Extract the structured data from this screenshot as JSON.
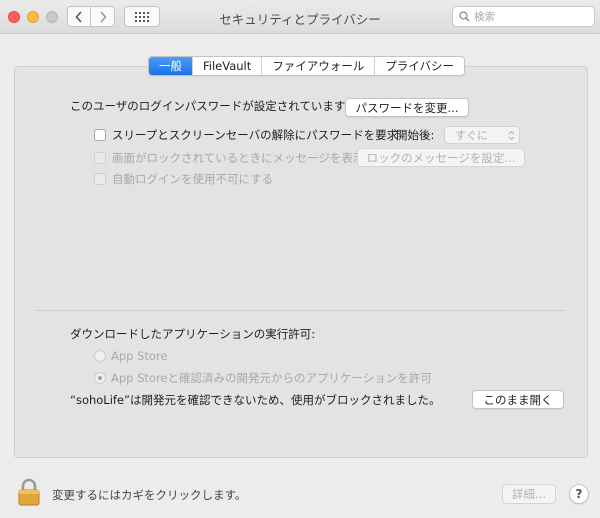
{
  "window": {
    "title": "セキュリティとプライバシー",
    "search_placeholder": "検索",
    "back_icon": "chevron-left-icon",
    "forward_icon": "chevron-right-icon",
    "grid_icon": "grid-icon"
  },
  "tabs": [
    {
      "label": "一般",
      "active": true
    },
    {
      "label": "FileVault",
      "active": false
    },
    {
      "label": "ファイアウォール",
      "active": false
    },
    {
      "label": "プライバシー",
      "active": false
    }
  ],
  "general": {
    "password_label": "このユーザのログインパスワードが設定されています",
    "change_password_button": "パスワードを変更...",
    "require_password_label": "スリープとスクリーンセーバの解除にパスワードを要求",
    "start_label": "開始後:",
    "start_value": "すぐに",
    "lock_message_label": "画面がロックされているときにメッセージを表示",
    "lock_message_button": "ロックのメッセージを設定...",
    "disable_autologin_label": "自動ログインを使用不可にする"
  },
  "downloads": {
    "heading": "ダウンロードしたアプリケーションの実行許可:",
    "option_app_store": "App Store",
    "option_app_store_identified": "App Storeと確認済みの開発元からのアプリケーションを許可",
    "blocked_message": "“sohoLife”は開発元を確認できないため、使用がブロックされました。",
    "open_anyway_button": "このまま開く"
  },
  "footer": {
    "lock_text": "変更するにはカギをクリックします。",
    "advanced_button": "詳細...",
    "help_label": "?"
  },
  "colors": {
    "tab_active": "#1a72e8",
    "close": "#fc605c",
    "minimize": "#fdbc40",
    "zoom_disabled": "#c9c9c9"
  }
}
